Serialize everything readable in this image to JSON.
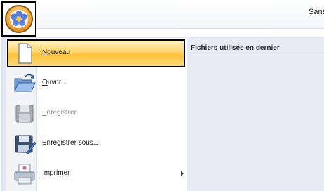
{
  "window": {
    "title": "Sans"
  },
  "app_button": {
    "icon": "flower-app-icon"
  },
  "recent": {
    "title": "Fichiers utilisés en dernier"
  },
  "menu": {
    "items": [
      {
        "label": "Nouveau",
        "icon": "new-document-icon",
        "enabled": true,
        "highlight": true
      },
      {
        "label": "Ouvrir...",
        "icon": "open-folder-icon",
        "enabled": true
      },
      {
        "label": "Enregistrer",
        "icon": "save-icon",
        "enabled": false
      },
      {
        "label": "Enregistrer sous...",
        "icon": "save-as-icon",
        "enabled": true
      },
      {
        "label": "Imprimer",
        "icon": "printer-icon",
        "enabled": true,
        "has_submenu": true
      }
    ]
  },
  "colors": {
    "highlight": "#ffc23a",
    "panel": "#e7ecf5",
    "app_orb": "#f0a53c"
  }
}
